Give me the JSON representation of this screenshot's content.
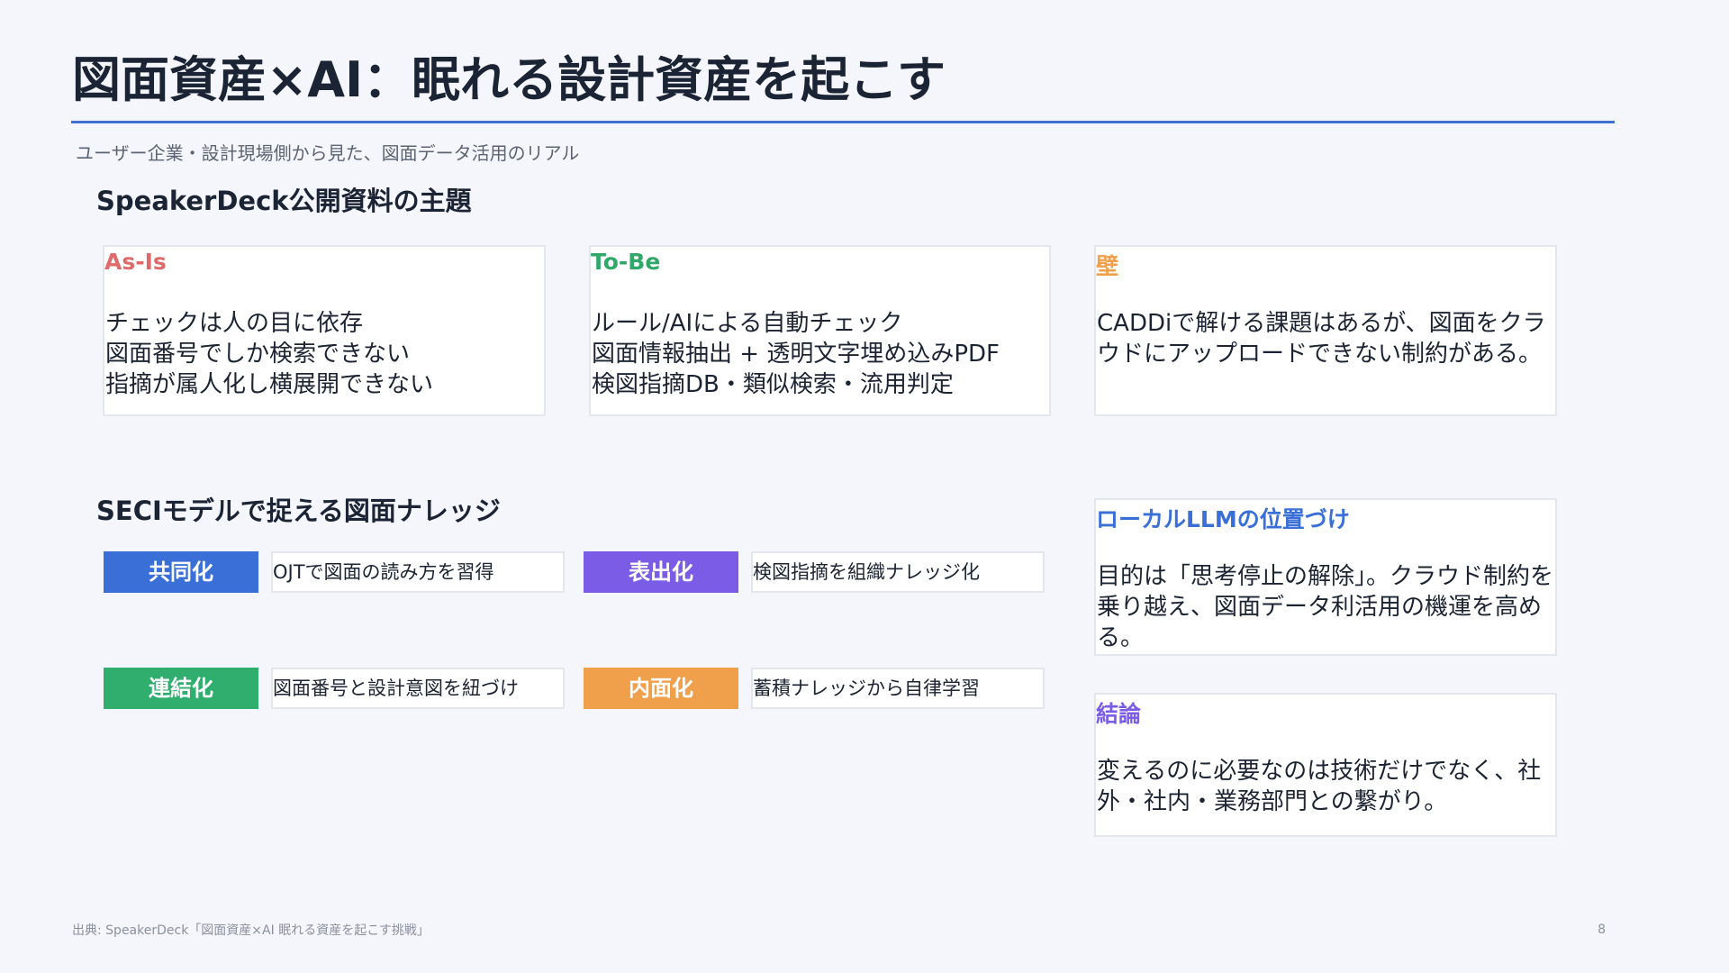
{
  "slide": {
    "title": "図面資産×AI：眠れる設計資産を起こす",
    "subtitle": "ユーザー企業・設計現場側から見た、図面データ活用のリアル",
    "footer": "出典: SpeakerDeck「図面資産×AI 眠れる資産を起こす挑戦」",
    "page_number": "8"
  },
  "topic_section": {
    "heading": "SpeakerDeck公開資料の主題",
    "cards": [
      {
        "title": "As-Is",
        "color": "#e06a6a",
        "lines": [
          "チェックは人の目に依存",
          "図面番号でしか検索できない",
          "指摘が属人化し横展開できない"
        ]
      },
      {
        "title": "To-Be",
        "color": "#2fa86a",
        "lines": [
          "ルール/AIによる自動チェック",
          "図面情報抽出 + 透明文字埋め込みPDF",
          "検図指摘DB・類似検索・流用判定"
        ]
      },
      {
        "title": "壁",
        "color": "#f0a04b",
        "text": "CADDiで解ける課題はあるが、図面をクラウドにアップロードできない制約がある。"
      }
    ]
  },
  "seci_section": {
    "heading": "SECIモデルで捉える図面ナレッジ",
    "items": [
      {
        "label": "共同化",
        "color": "#3a6fd8",
        "desc": "OJTで図面の読み方を習得"
      },
      {
        "label": "表出化",
        "color": "#7b5ce6",
        "desc": "検図指摘を組織ナレッジ化"
      },
      {
        "label": "連結化",
        "color": "#2fae6e",
        "desc": "図面番号と設計意図を紐づけ"
      },
      {
        "label": "内面化",
        "color": "#f0a04b",
        "desc": "蓄積ナレッジから自律学習"
      }
    ]
  },
  "side_cards": [
    {
      "title": "ローカルLLMの位置づけ",
      "color": "#3a6fd8",
      "text": "目的は「思考停止の解除」。クラウド制約を乗り越え、図面データ利活用の機運を高める。"
    },
    {
      "title": "結論",
      "color": "#7b5ce6",
      "text": "変えるのに必要なのは技術だけでなく、社外・社内・業務部門との繋がり。"
    }
  ]
}
